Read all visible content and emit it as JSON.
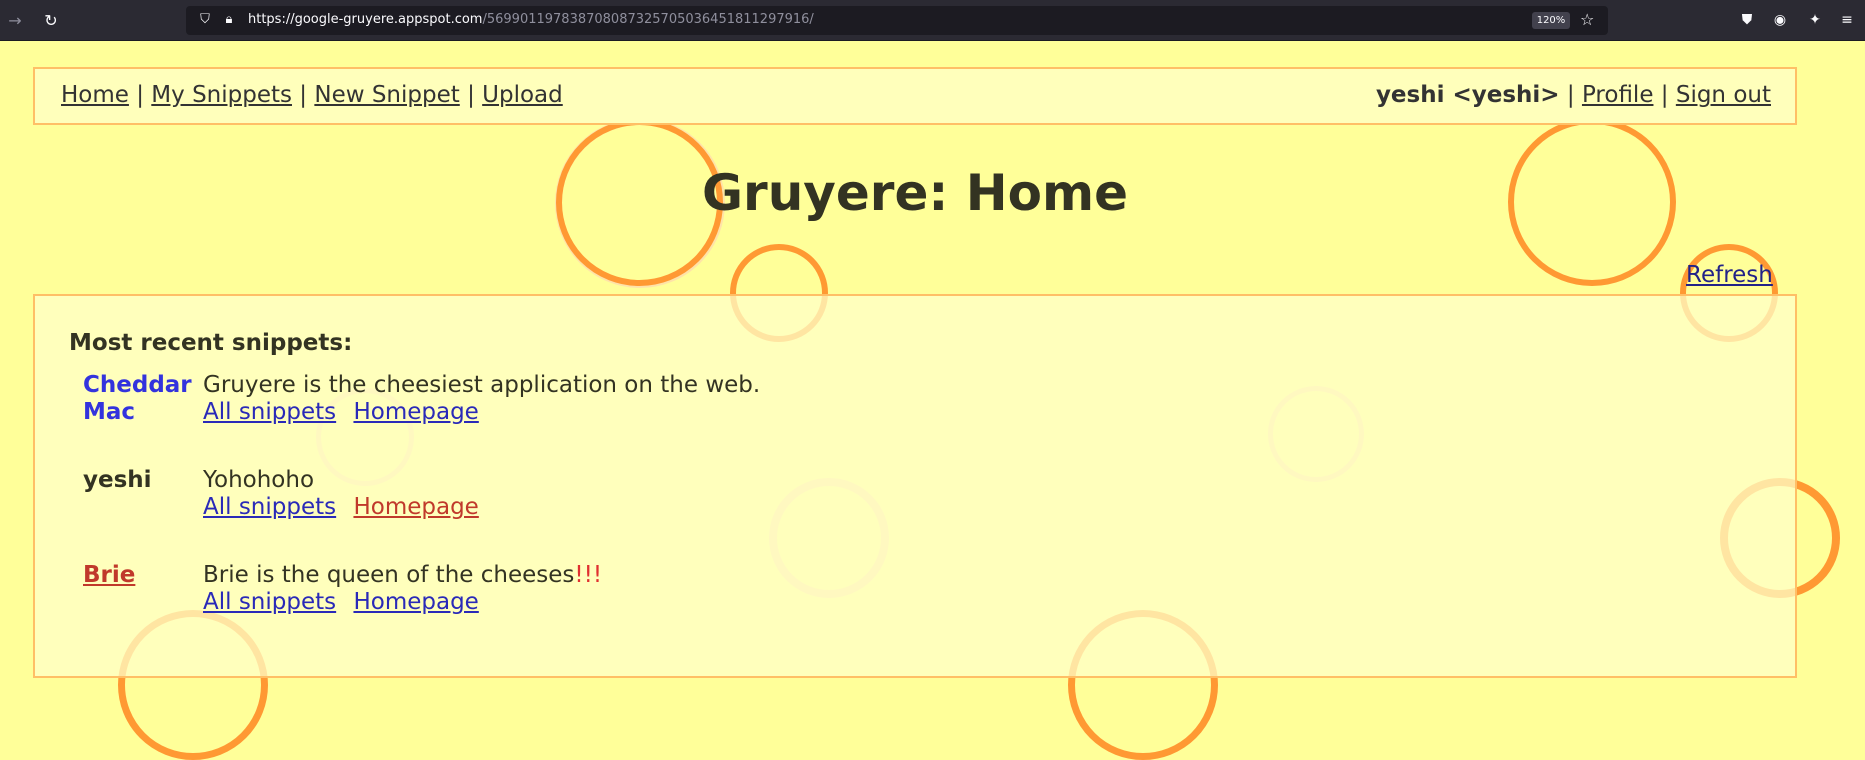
{
  "browser": {
    "url_host": "https://google-gruyere.appspot.com",
    "url_path": "/569901197838708087325705036451811297916/",
    "zoom": "120%",
    "back_icon": "arrow-right-icon",
    "reload_icon": "reload-icon"
  },
  "nav": {
    "left_links": [
      "Home",
      "My Snippets",
      "New Snippet",
      "Upload"
    ],
    "separator": "|",
    "user": "yeshi <yeshi>",
    "profile": "Profile",
    "sign_out": "Sign out"
  },
  "page_title": "Gruyere: Home",
  "refresh": "Refresh",
  "section_title": "Most recent snippets:",
  "snippets": [
    {
      "author_line1": "Cheddar",
      "author_line2": "Mac",
      "text": "Gruyere is the cheesiest application on the web.",
      "all_snippets": "All snippets",
      "homepage": "Homepage"
    },
    {
      "author_line1": "yeshi",
      "text": "Yohohoho",
      "all_snippets": "All snippets",
      "homepage": "Homepage"
    },
    {
      "author_line1": "Brie",
      "text": "Brie is the queen of the cheeses",
      "text_emphasis": "!!!",
      "all_snippets": "All snippets",
      "homepage": "Homepage"
    }
  ],
  "colors": {
    "background": "#ffff99",
    "accent_orange": "#ff9933",
    "link_blue": "#2a2ab8",
    "link_red": "#e03030"
  }
}
